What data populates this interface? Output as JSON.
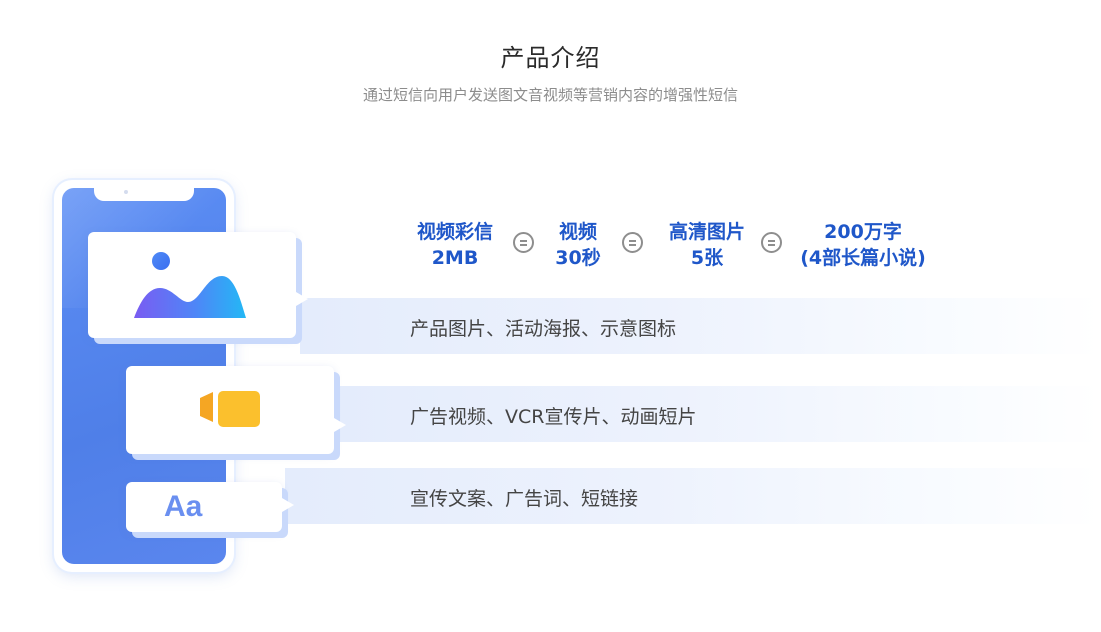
{
  "header": {
    "title": "产品介绍",
    "subtitle": "通过短信向用户发送图文音视频等营销内容的增强性短信"
  },
  "specs": [
    {
      "line1": "视频彩信",
      "line2": "2MB"
    },
    {
      "line1": "视频",
      "line2": "30秒"
    },
    {
      "line1": "高清图片",
      "line2": "5张"
    },
    {
      "line1": "200万字",
      "line2": "(4部长篇小说)"
    }
  ],
  "features": [
    {
      "text": "产品图片、活动海报、示意图标",
      "icon": "image-icon"
    },
    {
      "text": "广告视频、VCR宣传片、动画短片",
      "icon": "video-camera-icon"
    },
    {
      "text": "宣传文案、广告词、短链接",
      "icon": "text-icon",
      "icon_label": "Aa"
    }
  ],
  "colors": {
    "accent": "#1f57c9",
    "phone": "#5c8ef5",
    "video_icon": "#f7b500",
    "text_icon": "#6a8ff0"
  }
}
